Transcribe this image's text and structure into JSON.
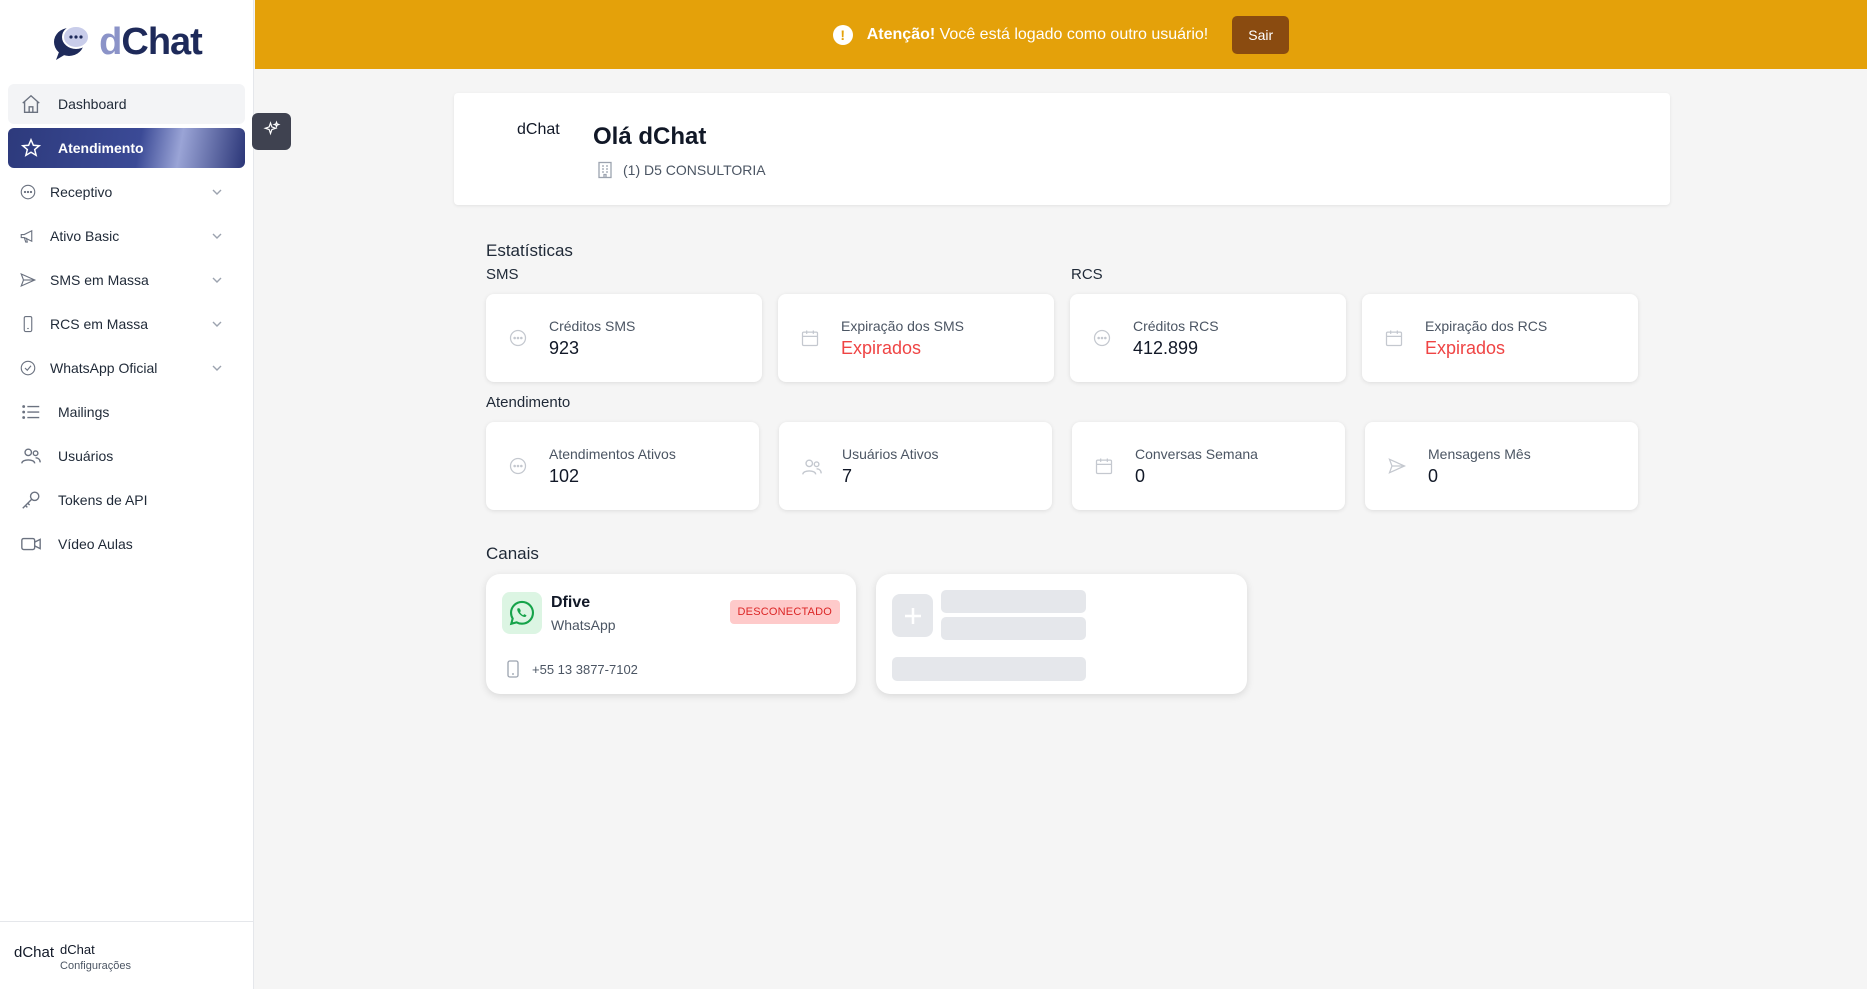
{
  "sidebar": {
    "brand_prefix": "d",
    "brand_suffix": "Chat",
    "items": [
      {
        "label": "Dashboard",
        "icon": "home-icon"
      },
      {
        "label": "Atendimento",
        "icon": "star-icon"
      },
      {
        "label": "Receptivo",
        "icon": "chat-icon"
      },
      {
        "label": "Ativo Basic",
        "icon": "megaphone-icon"
      },
      {
        "label": "SMS em Massa",
        "icon": "send-icon"
      },
      {
        "label": "RCS em Massa",
        "icon": "phone-icon"
      },
      {
        "label": "WhatsApp Oficial",
        "icon": "check-circle-icon"
      },
      {
        "label": "Mailings",
        "icon": "list-icon"
      },
      {
        "label": "Usuários",
        "icon": "users-icon"
      },
      {
        "label": "Tokens de API",
        "icon": "key-icon"
      },
      {
        "label": "Vídeo Aulas",
        "icon": "video-icon"
      }
    ],
    "footer": {
      "brand": "dChat",
      "name": "dChat",
      "sub": "Configurações"
    }
  },
  "banner": {
    "bold": "Atenção!",
    "text": " Você está logado como outro usuário!",
    "button": "Sair",
    "color": "#e4a10a"
  },
  "greeting": {
    "avatar_text": "dChat",
    "title": "Olá dChat",
    "company": "(1) D5 CONSULTORIA"
  },
  "stats": {
    "title": "Estatísticas",
    "sms_title": "SMS",
    "rcs_title": "RCS",
    "atendimento_title": "Atendimento",
    "sms_credits": {
      "label": "Créditos SMS",
      "value": "923"
    },
    "sms_expiry": {
      "label": "Expiração dos SMS",
      "value": "Expirados"
    },
    "rcs_credits": {
      "label": "Créditos RCS",
      "value": "412.899"
    },
    "rcs_expiry": {
      "label": "Expiração dos RCS",
      "value": "Expirados"
    },
    "active_attendances": {
      "label": "Atendimentos Ativos",
      "value": "102"
    },
    "active_users": {
      "label": "Usuários Ativos",
      "value": "7"
    },
    "week_conversations": {
      "label": "Conversas Semana",
      "value": "0"
    },
    "month_messages": {
      "label": "Mensagens Mês",
      "value": "0"
    }
  },
  "channels": {
    "title": "Canais",
    "items": [
      {
        "name": "Dfive",
        "type": "WhatsApp",
        "status": "DESCONECTADO",
        "phone": "+55 13 3877-7102"
      }
    ]
  }
}
